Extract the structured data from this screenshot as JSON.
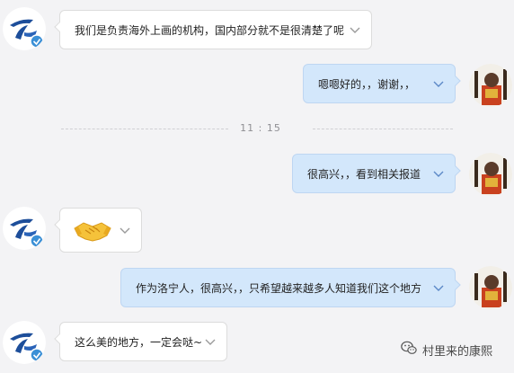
{
  "time_divider": "11 : 15",
  "messages": [
    {
      "direction": "incoming",
      "sender": "institution",
      "text": "我们是负责海外上画的机构，国内部分就不是很清楚了呢"
    },
    {
      "direction": "outgoing",
      "sender": "user",
      "text": "嗯嗯好的，，谢谢，，"
    },
    {
      "direction": "outgoing",
      "sender": "user",
      "text": "很高兴，，看到相关报道"
    },
    {
      "direction": "incoming",
      "sender": "institution",
      "type": "emoji",
      "emoji": "handshake-emoji"
    },
    {
      "direction": "outgoing",
      "sender": "user",
      "text": "作为洛宁人，很高兴，，只希望越来越多人知道我们这个地方"
    },
    {
      "direction": "incoming",
      "sender": "institution",
      "text": "这么美的地方，一定会哒~"
    }
  ],
  "watermark": {
    "icon": "wechat-icon",
    "text": "村里来的康熙"
  },
  "colors": {
    "background": "#f3f3f5",
    "incoming_bubble": "#ffffff",
    "outgoing_bubble": "#d3e7fb",
    "verified_badge": "#3a8fd6",
    "logo_blue": "#1d4e9a"
  }
}
